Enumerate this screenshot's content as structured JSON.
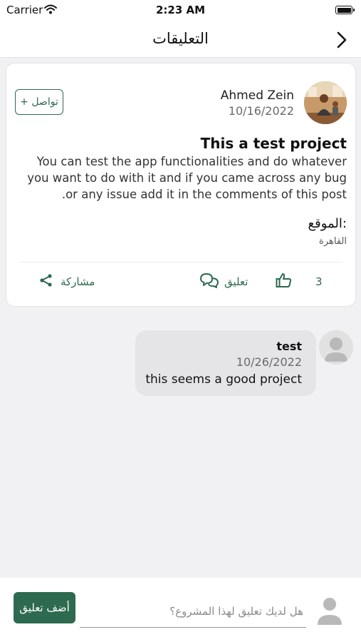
{
  "status_bar": {
    "carrier": "Carrier",
    "time": "2:23 AM"
  },
  "header": {
    "title": "التعليقات"
  },
  "post": {
    "author": "Ahmed Zein",
    "date": "10/16/2022",
    "follow_label": "+ تواصل",
    "title": "This a test project",
    "body": "You can test the app functionalities and do whatever you want to do with it and if you came across any bug or any issue add it in the comments of this post.",
    "location_label": "الموقع:",
    "location_value": "القاهرة",
    "like_count": "3",
    "comment_label": "تعليق",
    "share_label": "مشاركة"
  },
  "comments": [
    {
      "author": "test",
      "date": "10/26/2022",
      "text": "this seems a good project"
    }
  ],
  "composer": {
    "placeholder": "هل لديك تعليق لهذا المشروع؟",
    "value": "",
    "submit_label": "أضف تعليق"
  },
  "icons": {
    "back": "chevron-right-icon",
    "like": "thumbs-up-icon",
    "comment": "chat-bubbles-icon",
    "share": "share-icon",
    "avatar_placeholder": "user-silhouette-icon",
    "wifi": "wifi-icon",
    "battery": "battery-icon"
  },
  "colors": {
    "accent": "#2d6a4f",
    "background": "#f1f1f4",
    "bubble": "#e5e5e8",
    "card": "#ffffff"
  }
}
